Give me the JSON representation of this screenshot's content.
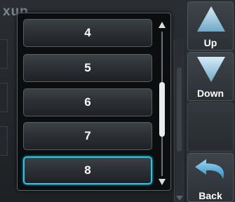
{
  "background": {
    "title_fragment": "xup"
  },
  "popup": {
    "items": [
      {
        "label": "4",
        "selected": false
      },
      {
        "label": "5",
        "selected": false
      },
      {
        "label": "6",
        "selected": false
      },
      {
        "label": "7",
        "selected": false
      },
      {
        "label": "8",
        "selected": true
      }
    ],
    "scroll_position": 0.55
  },
  "softkeys": {
    "up": {
      "label": "Up",
      "icon": "up-arrow-icon"
    },
    "down": {
      "label": "Down",
      "icon": "down-arrow-icon"
    },
    "back": {
      "label": "Back",
      "icon": "back-arrow-icon"
    }
  },
  "colors": {
    "selection_highlight": "#22c8e6",
    "arrow_fill": "#a9d4ec"
  }
}
